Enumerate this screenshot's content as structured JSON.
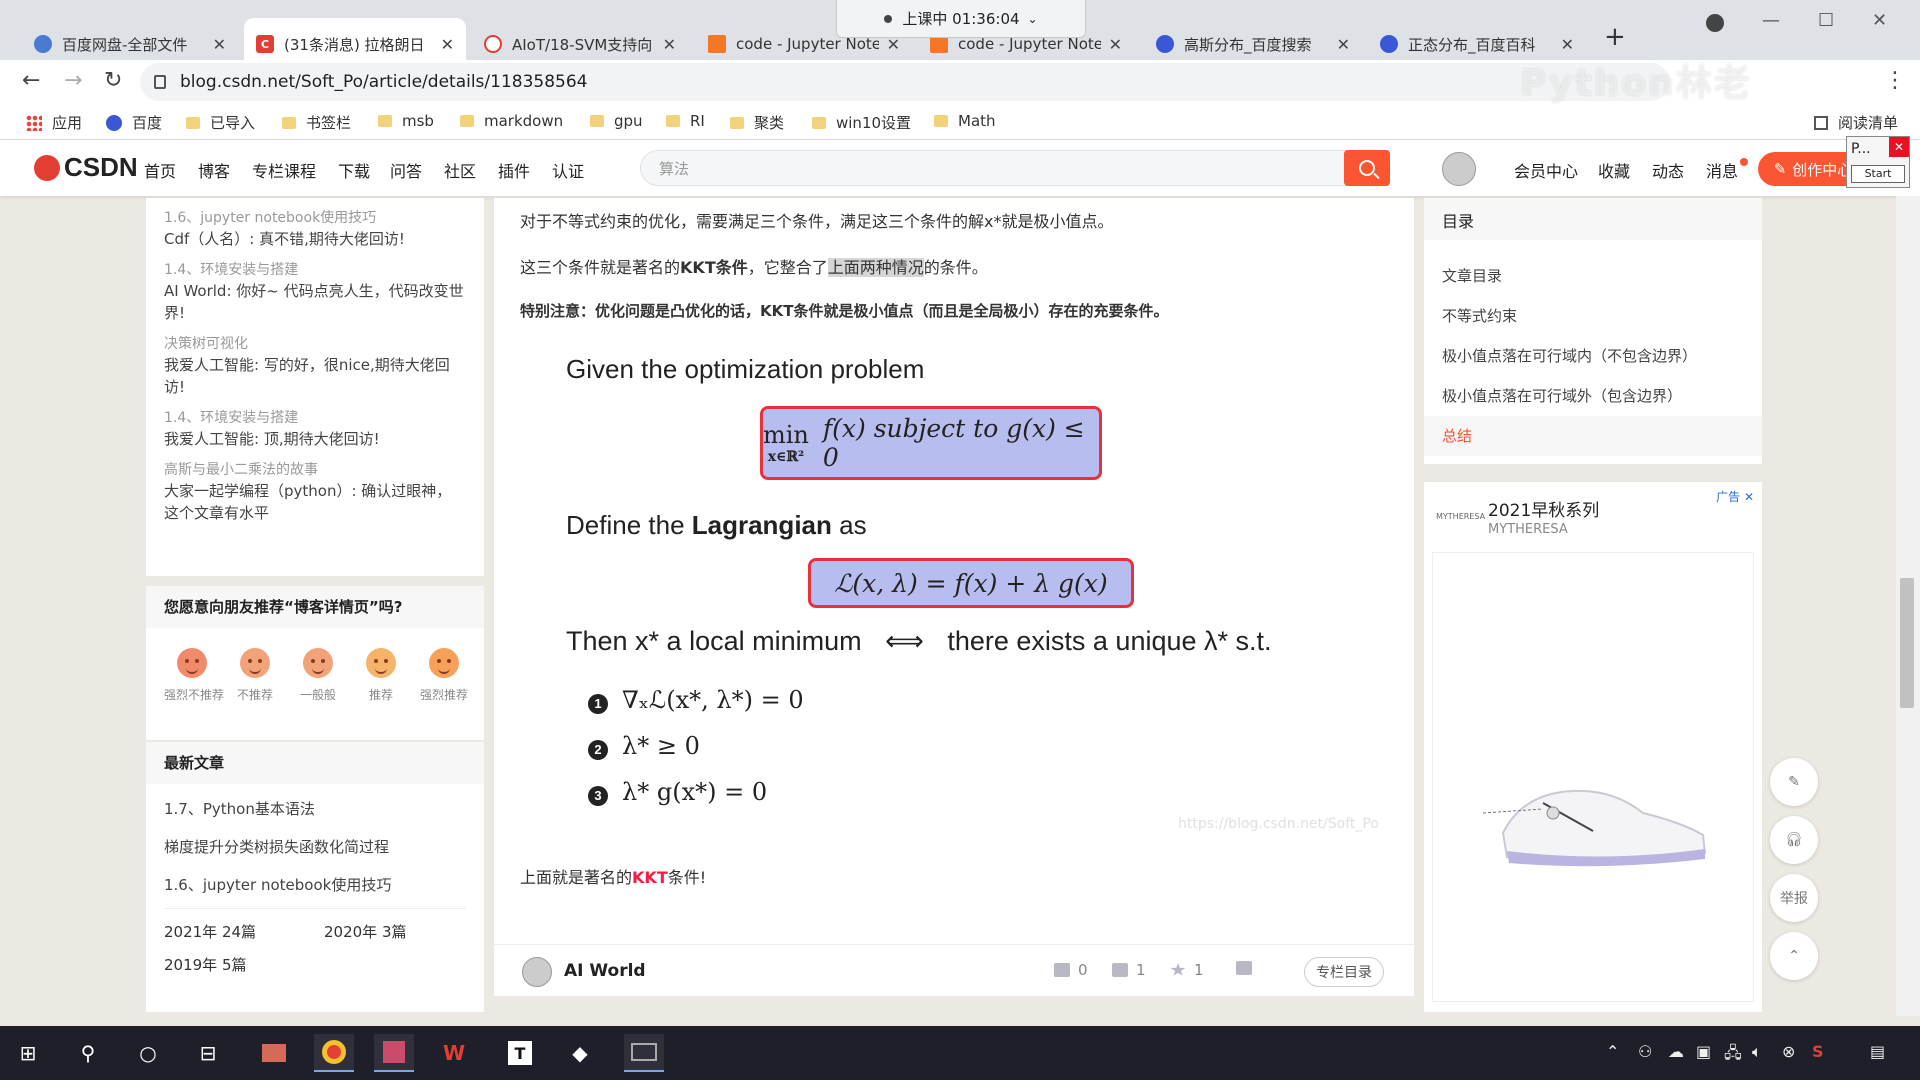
{
  "browser": {
    "tabs": [
      {
        "label": "百度网盘-全部文件",
        "color": "#4a7bd1"
      },
      {
        "label": "(31条消息) 拉格朗日",
        "color": "#e33e33"
      },
      {
        "label": "AIoT/18-SVM支持向",
        "color": "#e33e33"
      },
      {
        "label": "code - Jupyter Note",
        "color": "#f37726"
      },
      {
        "label": "code - Jupyter Note",
        "color": "#f37726"
      },
      {
        "label": "高斯分布_百度搜索",
        "color": "#3a58d6"
      },
      {
        "label": "正态分布_百度百科",
        "color": "#3a58d6"
      }
    ],
    "timer": "上课中 01:36:04",
    "url": "blog.csdn.net/Soft_Po/article/details/118358564",
    "watermark": "Python林老",
    "bookmarks": [
      "应用",
      "百度",
      "已导入",
      "书签栏",
      "msb",
      "markdown",
      "gpu",
      "RI",
      "聚类",
      "win10设置",
      "Math"
    ],
    "reading_list": "阅读清单"
  },
  "csdn": {
    "logo": "CSDN",
    "nav": [
      "首页",
      "博客",
      "专栏课程",
      "下载",
      "问答",
      "社区",
      "插件",
      "认证"
    ],
    "search_placeholder": "算法",
    "right_nav": [
      "会员中心",
      "收藏",
      "动态",
      "消息"
    ],
    "create_label": "创作中心",
    "popup": {
      "title": "P...",
      "button": "Start"
    }
  },
  "sidebar": {
    "comments": [
      {
        "article": "1.6、jupyter notebook使用技巧",
        "text": "Cdf（人名）: 真不错,期待大佬回访!"
      },
      {
        "article": "1.4、环境安装与搭建",
        "text": "AI World: 你好~ 代码点亮人生，代码改变世界!"
      },
      {
        "article": "决策树可视化",
        "text": "我爱人工智能: 写的好，很nice,期待大佬回访!"
      },
      {
        "article": "1.4、环境安装与搭建",
        "text": "我爱人工智能: 顶,期待大佬回访!"
      },
      {
        "article": "高斯与最小二乘法的故事",
        "text": "大家一起学编程（python）: 确认过眼神，这个文章有水平"
      }
    ],
    "recommend": {
      "title": "您愿意向朋友推荐“博客详情页”吗?",
      "options": [
        "强烈不推荐",
        "不推荐",
        "一般般",
        "推荐",
        "强烈推荐"
      ]
    },
    "latest": {
      "title": "最新文章",
      "items": [
        "1.7、Python基本语法",
        "梯度提升分类树损失函数化简过程",
        "1.6、jupyter notebook使用技巧"
      ],
      "archive": [
        "2021年 24篇",
        "2020年 3篇",
        "2019年 5篇"
      ]
    }
  },
  "article": {
    "p1": "对于不等式约束的优化，需要满足三个条件，满足这三个条件的解x*就是极小值点。",
    "p2_a": "这三个条件就是著名的",
    "p2_b": "KKT条件",
    "p2_c": "，它整合了",
    "p2_d": "上面两种情况",
    "p2_e": "的条件。",
    "p3": "特别注意：优化问题是凸优化的话，KKT条件就是极小值点（而且是全局极小）存在的充要条件。",
    "figure": {
      "given": "Given the optimization problem",
      "problem_min": "min",
      "problem_sub": "x∈ℝ²",
      "problem_rest": "f(x)  subject to  g(x) ≤ 0",
      "define_a": "Define the ",
      "define_b": "Lagrangian",
      "define_c": " as",
      "lagrangian": "ℒ(x, λ) = f(x) + λ g(x)",
      "then_a": "Then x* a local minimum",
      "then_arrow": "⟺",
      "then_b": "there exists a unique λ* s.t.",
      "conditions": [
        "∇ₓℒ(x*, λ*) = 0",
        "λ* ≥ 0",
        "λ* g(x*) = 0"
      ],
      "source": "https://blog.csdn.net/Soft_Po"
    },
    "p4_a": "上面就是著名的",
    "p4_b": "KKT",
    "p4_c": "条件!",
    "author": "AI World",
    "stats": {
      "likes": "0",
      "comments": "1",
      "favorites": "1"
    },
    "column_button": "专栏目录"
  },
  "toc": {
    "title": "目录",
    "items": [
      "文章目录",
      "不等式约束",
      "极小值点落在可行域内（不包含边界）",
      "极小值点落在可行域外（包含边界）",
      "总结"
    ]
  },
  "ad": {
    "title": "2021早秋系列",
    "brand": "MYTHERESA",
    "logo": "MYTHERESA",
    "tag": "广告 ✕"
  },
  "float_buttons": [
    "举报"
  ],
  "colors": {
    "accent": "#fc5531",
    "red_box": "#e8323a",
    "box_fill": "#b8bdf0"
  }
}
